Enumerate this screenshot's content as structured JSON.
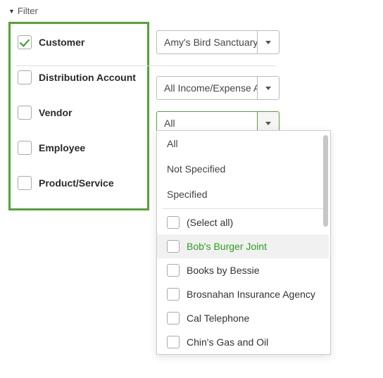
{
  "header": {
    "label": "Filter"
  },
  "filters": [
    {
      "label": "Customer",
      "checked": true
    },
    {
      "label": "Distribution Account",
      "checked": false
    },
    {
      "label": "Vendor",
      "checked": false
    },
    {
      "label": "Employee",
      "checked": false
    },
    {
      "label": "Product/Service",
      "checked": false
    }
  ],
  "combos": {
    "customer": {
      "value": "Amy's Bird Sanctuary"
    },
    "distribution": {
      "value": "All Income/Expense A"
    },
    "vendor": {
      "value": "All"
    }
  },
  "vendor_dropdown": {
    "scope_options": [
      "All",
      "Not Specified",
      "Specified"
    ],
    "select_all_label": "(Select all)",
    "items": [
      "Bob's Burger Joint",
      "Books by Bessie",
      "Brosnahan Insurance Agency",
      "Cal Telephone",
      "Chin's Gas and Oil"
    ],
    "highlighted_index": 0
  }
}
